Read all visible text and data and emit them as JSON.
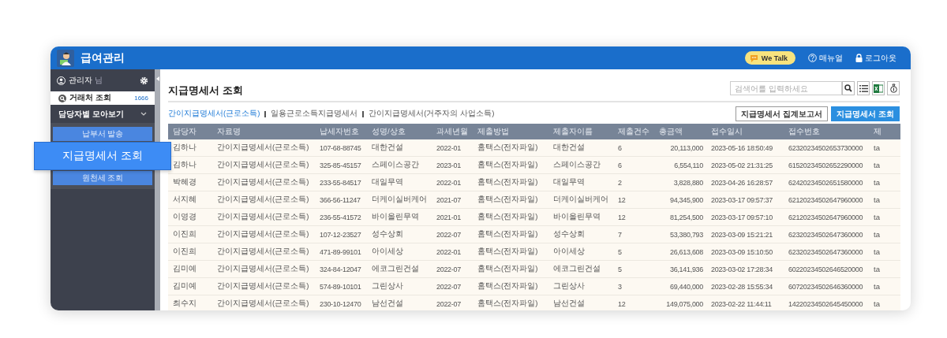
{
  "app": {
    "title": "급여관리"
  },
  "header_actions": [
    {
      "kind": "talk",
      "label": "We Talk"
    },
    {
      "kind": "manual",
      "label": "매뉴얼"
    },
    {
      "kind": "logout",
      "label": "로그아웃"
    }
  ],
  "sidebar": {
    "user": {
      "name": "관리자",
      "suffix": "님"
    },
    "items": [
      {
        "label": "거래처 조회",
        "count": "1666"
      }
    ],
    "group": {
      "label": "담당자별 모아보기",
      "expanded": true,
      "children": [
        {
          "label": "납부서 발송",
          "selected": false
        },
        {
          "label": "지급명세서 조회",
          "selected": true
        },
        {
          "label": "원천세 조회",
          "selected": false
        }
      ]
    }
  },
  "page": {
    "title": "지급명세서 조회",
    "search": {
      "placeholder": "검색어를 입력하세요"
    },
    "tabs": [
      {
        "label": "간이지급명세서(근로소득)",
        "selected": true
      },
      {
        "label": "일용근로소득지급명세서",
        "selected": false
      },
      {
        "label": "간이지급명세서(거주자의 사업소득)",
        "selected": false
      }
    ],
    "buttons": [
      {
        "label": "지급명세서 집계보고서",
        "kind": "outline"
      },
      {
        "label": "지급명세서 조회",
        "kind": "primary"
      }
    ]
  },
  "table": {
    "columns": [
      {
        "label": "담당자",
        "kind": "text"
      },
      {
        "label": "자료명",
        "kind": "text"
      },
      {
        "label": "납세자번호",
        "kind": "text"
      },
      {
        "label": "성명/상호",
        "kind": "text"
      },
      {
        "label": "과세년월",
        "kind": "text"
      },
      {
        "label": "제출방법",
        "kind": "text"
      },
      {
        "label": "제출자이름",
        "kind": "text"
      },
      {
        "label": "제출건수",
        "kind": "text"
      },
      {
        "label": "총금액",
        "kind": "amount"
      },
      {
        "label": "접수일시",
        "kind": "text"
      },
      {
        "label": "접수번호",
        "kind": "text"
      },
      {
        "label": "제",
        "kind": "text"
      }
    ],
    "rows": [
      [
        "김하나",
        "간이지급명세서(근로소득)",
        "107-68-88745",
        "대한건설",
        "2022-01",
        "홈택스(전자파일)",
        "대한건설",
        "6",
        "20,113,000",
        "2023-05-16 18:50:49",
        "62320234502653730000",
        "ta"
      ],
      [
        "김하나",
        "간이지급명세서(근로소득)",
        "325-85-45157",
        "스페이스공간",
        "2023-01",
        "홈택스(전자파일)",
        "스페이스공간",
        "6",
        "6,554,110",
        "2023-05-02 21:31:25",
        "61520234502652290000",
        "ta"
      ],
      [
        "박혜경",
        "간이지급명세서(근로소득)",
        "233-55-84517",
        "대일무역",
        "2022-01",
        "홈택스(전자파일)",
        "대일무역",
        "2",
        "3,828,880",
        "2023-04-26 16:28:57",
        "62420234502651580000",
        "ta"
      ],
      [
        "서지혜",
        "간이지급명세서(근로소득)",
        "366-56-11247",
        "더케이실버케어",
        "2021-07",
        "홈택스(전자파일)",
        "더케이실버케어",
        "12",
        "94,345,900",
        "2023-03-17 09:57:37",
        "62120234502647960000",
        "ta"
      ],
      [
        "이영경",
        "간이지급명세서(근로소득)",
        "236-55-41572",
        "바이올린무역",
        "2021-01",
        "홈택스(전자파일)",
        "바이올린무역",
        "12",
        "81,254,500",
        "2023-03-17 09:57:10",
        "62120234502647960000",
        "ta"
      ],
      [
        "이진희",
        "간이지급명세서(근로소득)",
        "107-12-23527",
        "성수상회",
        "2022-07",
        "홈택스(전자파일)",
        "성수상회",
        "7",
        "53,380,793",
        "2023-03-09 15:21:21",
        "62320234502647360000",
        "ta"
      ],
      [
        "이진희",
        "간이지급명세서(근로소득)",
        "471-89-99101",
        "아이세상",
        "2022-01",
        "홈택스(전자파일)",
        "아이세상",
        "5",
        "26,613,608",
        "2023-03-09 15:10:50",
        "62320234502647360000",
        "ta"
      ],
      [
        "김미예",
        "간이지급명세서(근로소득)",
        "324-84-12047",
        "에코그린건설",
        "2022-07",
        "홈택스(전자파일)",
        "에코그린건설",
        "5",
        "36,141,936",
        "2023-03-02 17:28:34",
        "60220234502646520000",
        "ta"
      ],
      [
        "김미예",
        "간이지급명세서(근로소득)",
        "574-89-10101",
        "그린상사",
        "2022-07",
        "홈택스(전자파일)",
        "그린상사",
        "3",
        "69,440,000",
        "2023-02-28 15:55:34",
        "60720234502646360000",
        "ta"
      ],
      [
        "최수지",
        "간이지급명세서(근로소득)",
        "230-10-12470",
        "남선건설",
        "2022-07",
        "홈택스(전자파일)",
        "남선건설",
        "12",
        "149,075,000",
        "2023-02-22 11:44:11",
        "14220234502645450000",
        "ta"
      ]
    ]
  }
}
